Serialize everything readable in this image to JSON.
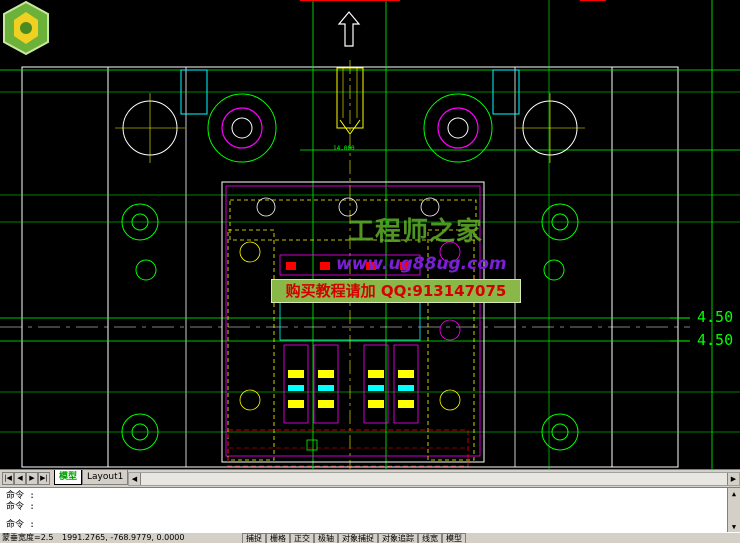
{
  "dimension_labels": [
    "4.50",
    "4.50"
  ],
  "small_dim_label": "14.000",
  "watermark": {
    "title": "工程师之家",
    "url": "www.ug88ug.com",
    "banner": "购买教程请加 QQ:913147075"
  },
  "tabs": {
    "model": "模型",
    "layout": "Layout1"
  },
  "nav_arrows": [
    "|◀",
    "◀",
    "▶",
    "▶|"
  ],
  "command_lines": [
    "命令 :",
    "命令 :",
    "命令 :"
  ],
  "status": {
    "prompt_text": "蒙垂宽度=2.5",
    "coordinates": "1991.2765,  -768.9779,  0.0000",
    "toggles": [
      "捕捉",
      "栅格",
      "正交",
      "极轴",
      "对象捕捉",
      "对象追踪",
      "线宽",
      "模型"
    ]
  },
  "colors": {
    "canvas_bg": "#000000",
    "green": "#00ff00",
    "white": "#ffffff",
    "yellow": "#ffff00",
    "magenta": "#ff00ff",
    "cyan": "#00ffff",
    "red": "#ff0000"
  }
}
